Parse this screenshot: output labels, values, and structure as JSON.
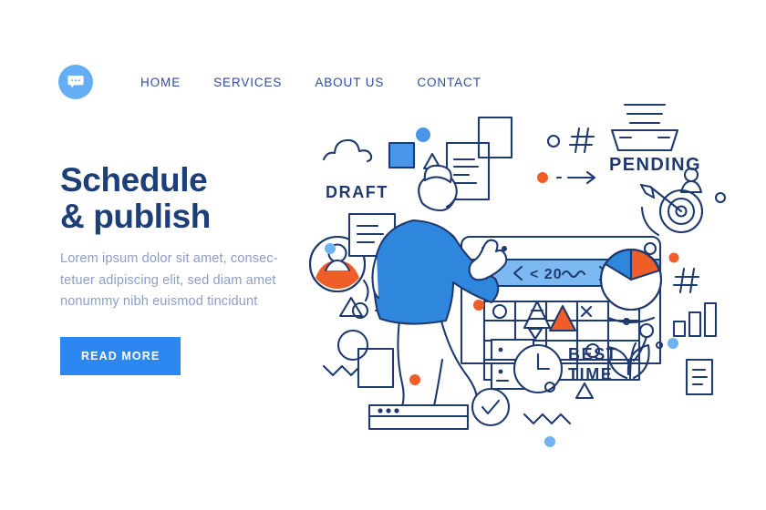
{
  "brand": {
    "logo_icon": "speech-bubble-icon",
    "logo_bg": "#63aef5"
  },
  "nav": {
    "items": [
      {
        "label": "HOME"
      },
      {
        "label": "SERVICES"
      },
      {
        "label": "ABOUT US"
      },
      {
        "label": "CONTACT"
      }
    ]
  },
  "hero": {
    "title": "Schedule\n& publish",
    "paragraph": "Lorem ipsum dolor sit amet, consec-\ntetuer adipiscing elit, sed diam amet\nnonummy nibh euismod tincidunt",
    "cta_label": "READ MORE",
    "title_color": "#1d3f77",
    "paragraph_color": "#8c9dc9",
    "cta_bg": "#2d87f0"
  },
  "illustration": {
    "alt": "doodle illustration of a person scheduling on a calendar",
    "labels": {
      "draft": "DRAFT",
      "pending": "PENDING",
      "best_time_line1": "BEST",
      "best_time_line2": "TIME",
      "calendar_nav": "< 20"
    },
    "colors": {
      "ink": "#1f3a6e",
      "blue_fill": "#4a95e8",
      "light_blue": "#7cb8f2",
      "pale_blue": "#cfe3fa",
      "orange": "#ef5d29",
      "shirt": "#2f86dd"
    },
    "icons": [
      "cloud-icon",
      "square-icon",
      "triangle-icon",
      "dot-icon",
      "document-icon",
      "heart-bubble-icon",
      "avatar-icon",
      "hash-icon",
      "inbox-tray-icon",
      "person-icon",
      "target-icon",
      "pie-chart-icon",
      "bar-chart-icon",
      "clock-icon",
      "checklist-icon",
      "leaf-icon",
      "checkmark-circle-icon",
      "zigzag-icon",
      "arrow-icon",
      "calendar-window-icon",
      "pyramid-icon",
      "note-icon"
    ]
  },
  "chart_data": {
    "type": "pie",
    "title": "",
    "labels": [
      "slice-blue",
      "slice-orange",
      "slice-white"
    ],
    "values": [
      20,
      22,
      58
    ],
    "colors": [
      "#2f86dd",
      "#ef5d29",
      "#ffffff"
    ]
  }
}
